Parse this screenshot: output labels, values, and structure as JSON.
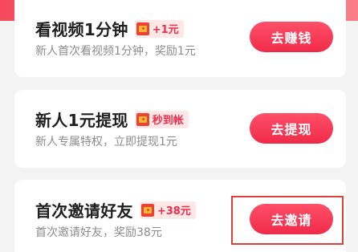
{
  "tasks": [
    {
      "title": "看视频1分钟",
      "tag": "+1元",
      "desc": "新人首次看视频1分钟，奖励1元",
      "button": "去赚钱"
    },
    {
      "title": "新人1元提现",
      "tag": "秒到帐",
      "desc": "新人专属特权，立即提现1元",
      "button": "去提现"
    },
    {
      "title": "首次邀请好友",
      "tag": "+38元",
      "desc": "首次邀请好友，奖励38元",
      "button": "去邀请"
    }
  ],
  "colors": {
    "accent": "#f02b4a",
    "tag_bg": "#fde7e7",
    "highlight": "#d9413a"
  },
  "icons": {
    "tag_icon": "red-envelope-icon"
  }
}
